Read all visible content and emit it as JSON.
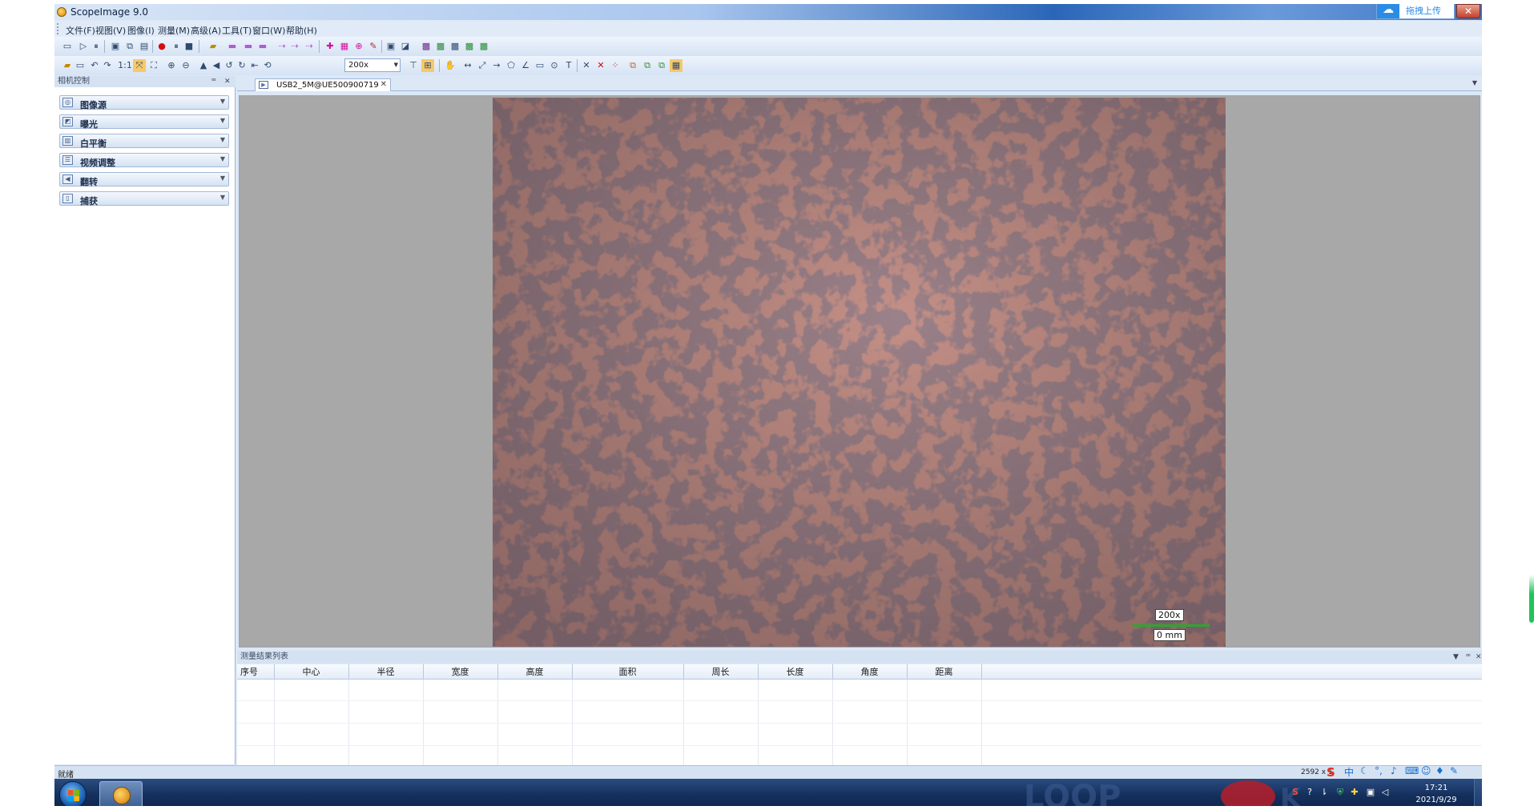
{
  "window": {
    "title": "ScopeImage 9.0",
    "upload_label": "拖拽上传",
    "close_glyph": "✕"
  },
  "menu": [
    "文件(F)",
    "视图(V)",
    "图像(I)",
    "测量(M)",
    "高级(A)",
    "工具(T)",
    "窗口(W)",
    "帮助(H)"
  ],
  "toolbar": {
    "ratio_label": "1:1",
    "zoom_value": "200x"
  },
  "left_panel": {
    "title": "相机控制",
    "pin_glyph": "ꟹ",
    "close_glyph": "✕",
    "sections": [
      {
        "label": "图像源",
        "icon": "camera-source-icon"
      },
      {
        "label": "曝光",
        "icon": "exposure-icon"
      },
      {
        "label": "白平衡",
        "icon": "white-balance-icon"
      },
      {
        "label": "视频调整",
        "icon": "video-adjust-icon"
      },
      {
        "label": "翻转",
        "icon": "flip-icon"
      },
      {
        "label": "捕获",
        "icon": "capture-icon"
      }
    ]
  },
  "document": {
    "tab_label": "USB2_5M@UE500900719",
    "scalebar_mag": "200x",
    "scalebar_len": "0 mm"
  },
  "results": {
    "title": "测量结果列表",
    "columns": [
      "序号",
      "中心",
      "半径",
      "宽度",
      "高度",
      "面积",
      "周长",
      "长度",
      "角度",
      "距离"
    ]
  },
  "status": {
    "text": "就绪",
    "resolution": "2592 x 1"
  },
  "ime": {
    "lang": "中"
  },
  "taskbar": {
    "time": "17:21",
    "date": "2021/9/29"
  },
  "colors": {
    "accent": "#2b8ce6",
    "panel_bg": "#dde8f6",
    "scalebar": "#2fa52f",
    "taskbar": "#15305e"
  }
}
